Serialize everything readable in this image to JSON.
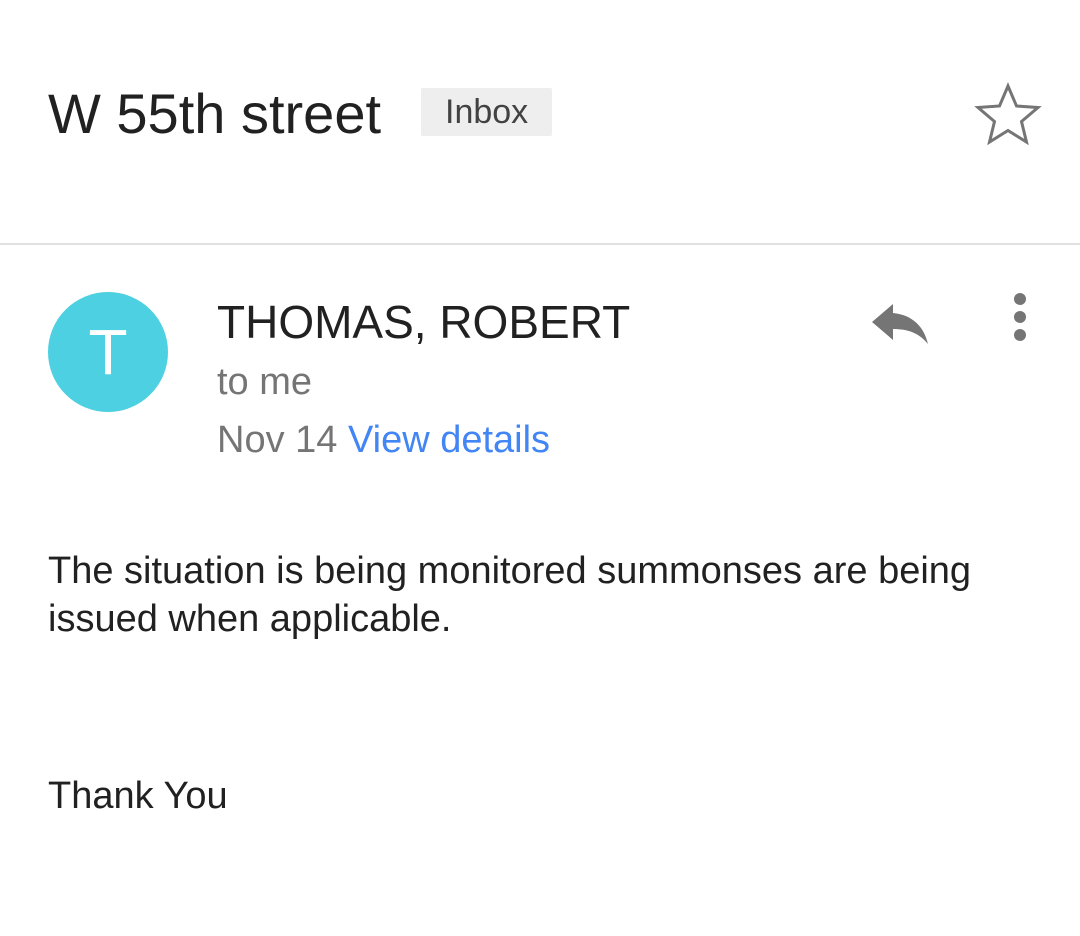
{
  "header": {
    "subject": "W 55th street",
    "label": "Inbox",
    "star_icon": "star-outline-icon"
  },
  "message": {
    "avatar_letter": "T",
    "avatar_color": "#4dd0e1",
    "sender": "THOMAS, ROBERT",
    "recipient": "to me",
    "date": "Nov 14",
    "view_details": "View details",
    "reply_icon": "reply-icon",
    "more_icon": "more-vert-icon",
    "body": "The situation is being monitored summonses are being issued when applicable.",
    "closing": "Thank You"
  },
  "colors": {
    "link": "#4285f4",
    "secondary_text": "#757575",
    "icon": "#757575"
  }
}
